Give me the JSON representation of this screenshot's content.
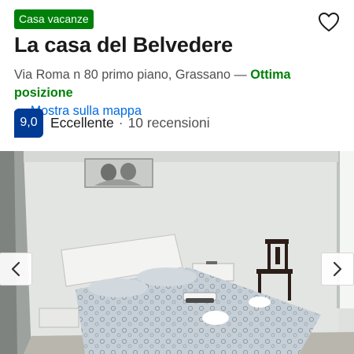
{
  "listing": {
    "type_badge": "Casa vacanze",
    "title": "La casa del Belvedere",
    "address": "Via Roma n 80 primo piano, Grassano",
    "location_dash": " — ",
    "location_label": "Ottima posizione",
    "map_link_dash": "— ",
    "map_link": "Mostra sulla mappa"
  },
  "rating": {
    "score": "9,0",
    "word": "Eccellente",
    "separator": "·",
    "reviews": "10 recensioni"
  },
  "icons": {
    "favorite": "heart-outline-icon",
    "prev": "chevron-left-icon",
    "next": "chevron-right-icon"
  },
  "colors": {
    "badge_green": "#008009",
    "score_blue": "#003b95",
    "link_blue": "#006ce4"
  }
}
